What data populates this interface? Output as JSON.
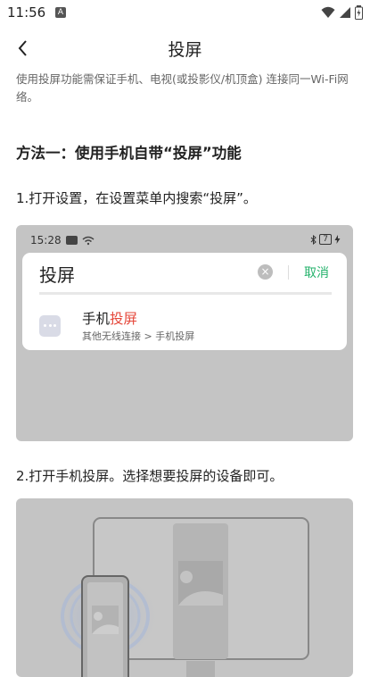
{
  "status_bar": {
    "time": "11:56",
    "notification_letter": "A"
  },
  "header": {
    "title": "投屏"
  },
  "intro_note": "使用投屏功能需保证手机、电视(或投影仪/机顶盒) 连接同一Wi-Fi网络。",
  "method_title": "方法一：使用手机自带“投屏”功能",
  "step1": {
    "text": "1.打开设置，在设置菜单内搜索“投屏”。",
    "screenshot": {
      "time": "15:28",
      "battery": "7",
      "search_query": "投屏",
      "clear_symbol": "×",
      "cancel_label": "取消",
      "result_title_prefix": "手机",
      "result_title_highlight": "投屏",
      "result_path": "其他无线连接 > 手机投屏"
    }
  },
  "step2": {
    "text": "2.打开手机投屏。选择想要投屏的设备即可。"
  },
  "colors": {
    "cancel_green": "#23b26b",
    "highlight_red": "#e5473a",
    "illustration_bg": "#c4c4c4"
  }
}
